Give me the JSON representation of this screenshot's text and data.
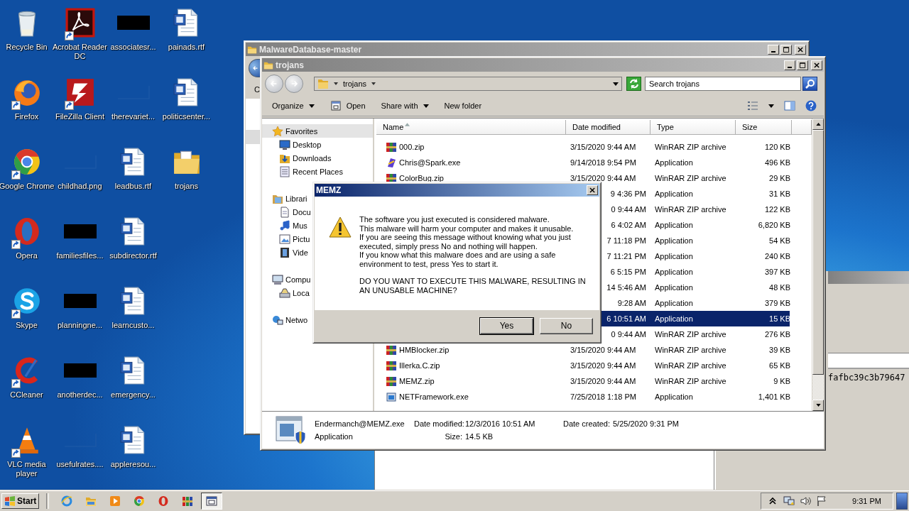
{
  "desktop_icons": [
    {
      "label": "Recycle Bin",
      "kind": "recycle",
      "shortcut": false
    },
    {
      "label": "Firefox",
      "kind": "firefox",
      "shortcut": true
    },
    {
      "label": "Google Chrome",
      "kind": "chrome",
      "shortcut": true
    },
    {
      "label": "Opera",
      "kind": "opera",
      "shortcut": true
    },
    {
      "label": "Skype",
      "kind": "skype",
      "shortcut": true
    },
    {
      "label": "CCleaner",
      "kind": "ccleaner",
      "shortcut": true
    },
    {
      "label": "VLC media player",
      "kind": "vlc",
      "shortcut": true
    },
    {
      "label": "Acrobat Reader DC",
      "kind": "acrobat",
      "shortcut": true
    },
    {
      "label": "FileZilla Client",
      "kind": "filezilla",
      "shortcut": true
    },
    {
      "label": "childhad.png",
      "kind": "blank",
      "shortcut": false
    },
    {
      "label": "familiesfiles...",
      "kind": "black",
      "shortcut": false
    },
    {
      "label": "planningne...",
      "kind": "black",
      "shortcut": false
    },
    {
      "label": "anotherdec...",
      "kind": "black",
      "shortcut": false
    },
    {
      "label": "usefulrates....",
      "kind": "blank",
      "shortcut": false
    },
    {
      "label": "associatesr...",
      "kind": "black",
      "shortcut": false
    },
    {
      "label": "therevariet...",
      "kind": "blank",
      "shortcut": false
    },
    {
      "label": "leadbus.rtf",
      "kind": "word",
      "shortcut": false
    },
    {
      "label": "subdirector.rtf",
      "kind": "word",
      "shortcut": false
    },
    {
      "label": "learncusto...",
      "kind": "word",
      "shortcut": false
    },
    {
      "label": "emergency...",
      "kind": "word",
      "shortcut": false
    },
    {
      "label": "appleresou...",
      "kind": "word",
      "shortcut": false
    },
    {
      "label": "painads.rtf",
      "kind": "word",
      "shortcut": false
    },
    {
      "label": "politicsenter...",
      "kind": "word",
      "shortcut": false
    },
    {
      "label": "trojans",
      "kind": "folder",
      "shortcut": false
    }
  ],
  "back_window": {
    "text": "fafbc39c3b79647"
  },
  "parent_window": {
    "title": "MalwareDatabase-master",
    "toolbar_text": "C"
  },
  "explorer": {
    "title": "trojans",
    "crumb": "trojans",
    "search_placeholder": "Search trojans",
    "toolbar": [
      {
        "label": "Organize",
        "kind": "menu"
      },
      {
        "label": "Open",
        "kind": "open"
      },
      {
        "label": "Share with",
        "kind": "menu"
      },
      {
        "label": "New folder",
        "kind": "plain"
      }
    ],
    "nav": [
      {
        "label": "Favorites",
        "kind": "favorites",
        "selected": true,
        "children": [
          {
            "label": "Desktop",
            "kind": "desktop",
            "selected": false
          },
          {
            "label": "Downloads",
            "kind": "downloads",
            "selected": false
          },
          {
            "label": "Recent Places",
            "kind": "recent",
            "selected": false
          }
        ]
      },
      {
        "label": "Librari",
        "kind": "libraries",
        "selected": false,
        "children": [
          {
            "label": "Docu",
            "kind": "documents",
            "selected": false
          },
          {
            "label": "Mus",
            "kind": "music",
            "selected": false
          },
          {
            "label": "Pictu",
            "kind": "pictures",
            "selected": false
          },
          {
            "label": "Vide",
            "kind": "videos",
            "selected": false
          }
        ]
      },
      {
        "label": "Compu",
        "kind": "computer",
        "selected": false,
        "children": [
          {
            "label": "Loca",
            "kind": "disk",
            "selected": false
          }
        ]
      },
      {
        "label": "Netwo",
        "kind": "network",
        "selected": false
      }
    ],
    "columns": [
      "Name",
      "Date modified",
      "Type",
      "Size"
    ],
    "files": [
      {
        "name": "000.zip",
        "kind": "zip",
        "date": "3/15/2020 9:44 AM",
        "type": "WinRAR ZIP archive",
        "size": "120 KB",
        "selected": false
      },
      {
        "name": "Chris@Spark.exe",
        "kind": "rainbow",
        "date": "9/14/2018 9:54 PM",
        "type": "Application",
        "size": "496 KB",
        "selected": false
      },
      {
        "name": "ColorBug.zip",
        "kind": "zip",
        "date": "3/15/2020 9:44 AM",
        "type": "WinRAR ZIP archive",
        "size": "29 KB",
        "selected": false
      },
      {
        "date": "9 4:36 PM",
        "type": "Application",
        "size": "31 KB",
        "selected": false
      },
      {
        "date": "0 9:44 AM",
        "type": "WinRAR ZIP archive",
        "size": "122 KB",
        "selected": false
      },
      {
        "date": "6 4:02 AM",
        "type": "Application",
        "size": "6,820 KB",
        "selected": false
      },
      {
        "date": "7 11:18 PM",
        "type": "Application",
        "size": "54 KB",
        "selected": false
      },
      {
        "date": "7 11:21 PM",
        "type": "Application",
        "size": "240 KB",
        "selected": false
      },
      {
        "date": "6 5:15 PM",
        "type": "Application",
        "size": "397 KB",
        "selected": false
      },
      {
        "date": "14 5:46 AM",
        "type": "Application",
        "size": "48 KB",
        "selected": false
      },
      {
        "date": "9:28 AM",
        "type": "Application",
        "size": "379 KB",
        "selected": false
      },
      {
        "date": "6 10:51 AM",
        "type": "Application",
        "size": "15 KB",
        "selected": true
      },
      {
        "date": "0 9:44 AM",
        "type": "WinRAR ZIP archive",
        "size": "276 KB",
        "selected": false
      },
      {
        "name": "HMBlocker.zip",
        "kind": "zip",
        "date": "3/15/2020 9:44 AM",
        "type": "WinRAR ZIP archive",
        "size": "39 KB",
        "selected": false
      },
      {
        "name": "Illerka.C.zip",
        "kind": "zip",
        "date": "3/15/2020 9:44 AM",
        "type": "WinRAR ZIP archive",
        "size": "65 KB",
        "selected": false
      },
      {
        "name": "MEMZ.zip",
        "kind": "zip",
        "date": "3/15/2020 9:44 AM",
        "type": "WinRAR ZIP archive",
        "size": "9 KB",
        "selected": false
      },
      {
        "name": "NETFramework.exe",
        "kind": "setup",
        "date": "7/25/2018 1:18 PM",
        "type": "Application",
        "size": "1,401 KB",
        "selected": false
      }
    ],
    "details": {
      "name": "Endermanch@MEMZ.exe",
      "type": "Application",
      "modified_label": "Date modified:",
      "modified": "12/3/2016 10:51 AM",
      "created_label": "Date created:",
      "created": "5/25/2020 9:31 PM",
      "size_label": "Size:",
      "size": "14.5 KB"
    }
  },
  "dialog": {
    "title": "MEMZ",
    "lines": [
      "The software you just executed is considered malware.",
      "This malware will harm your computer and makes it unusable.",
      "If you are seeing this message without knowing what you just executed, simply press No and nothing will happen.",
      "If you know what this malware does and are using a safe environment to test, press Yes to start it."
    ],
    "question": "DO YOU WANT TO EXECUTE THIS MALWARE, RESULTING IN AN UNUSABLE MACHINE?",
    "buttons": [
      {
        "label": "Yes",
        "selected": true
      },
      {
        "label": "No",
        "selected": false
      }
    ]
  },
  "taskbar": {
    "start": "Start",
    "items": [
      {
        "kind": "ie",
        "selected": false
      },
      {
        "kind": "folder",
        "selected": false
      },
      {
        "kind": "media",
        "selected": false
      },
      {
        "kind": "chrome",
        "selected": false
      },
      {
        "kind": "opera",
        "selected": false
      },
      {
        "kind": "winrar",
        "selected": false
      },
      {
        "kind": "window",
        "selected": true
      }
    ],
    "tray": [
      {
        "kind": "arrow"
      },
      {
        "kind": "network"
      },
      {
        "kind": "speaker"
      },
      {
        "kind": "flag"
      }
    ],
    "clock": "9:31 PM"
  }
}
